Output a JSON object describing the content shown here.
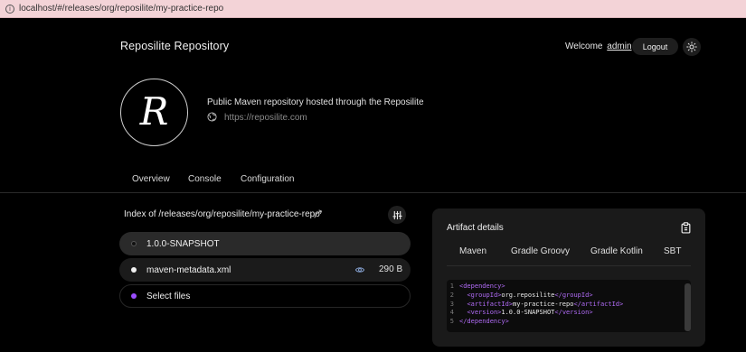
{
  "browser": {
    "url": "localhost/#/releases/org/reposilite/my-practice-repo"
  },
  "header": {
    "title": "Reposilite Repository",
    "welcome": "Welcome",
    "username": "admin",
    "logout_label": "Logout",
    "theme_icon": "sun-icon"
  },
  "repo": {
    "logo_letter": "R",
    "description": "Public Maven repository hosted through the Reposilite",
    "link": "https://reposilite.com"
  },
  "tabs": [
    {
      "label": "Overview"
    },
    {
      "label": "Console"
    },
    {
      "label": "Configuration"
    }
  ],
  "index": {
    "title": "Index of /releases/org/reposilite/my-practice-repo",
    "rows": [
      {
        "name": "1.0.0-SNAPSHOT"
      },
      {
        "name": "maven-metadata.xml",
        "size": "290 B"
      },
      {
        "name": "Select files"
      }
    ]
  },
  "artifact": {
    "title": "Artifact details",
    "tabs": [
      {
        "label": "Maven"
      },
      {
        "label": "Gradle Groovy"
      },
      {
        "label": "Gradle Kotlin"
      },
      {
        "label": "SBT"
      }
    ],
    "code": {
      "line_numbers": [
        "1",
        "2",
        "3",
        "4",
        "5"
      ],
      "l1_open": "<dependency>",
      "l2_open": "<groupId>",
      "l2_val": "org.reposilite",
      "l2_close": "</groupId>",
      "l3_open": "<artifactId>",
      "l3_val": "my-practice-repo",
      "l3_close": "</artifactId>",
      "l4_open": "<version>",
      "l4_val": "1.0.0-SNAPSHOT",
      "l4_close": "</version>",
      "l5_close": "</dependency>"
    }
  },
  "colors": {
    "accent": "#9b4dff",
    "tag": "#b06bf5",
    "background": "#000000",
    "panel": "#1a1a1a"
  }
}
